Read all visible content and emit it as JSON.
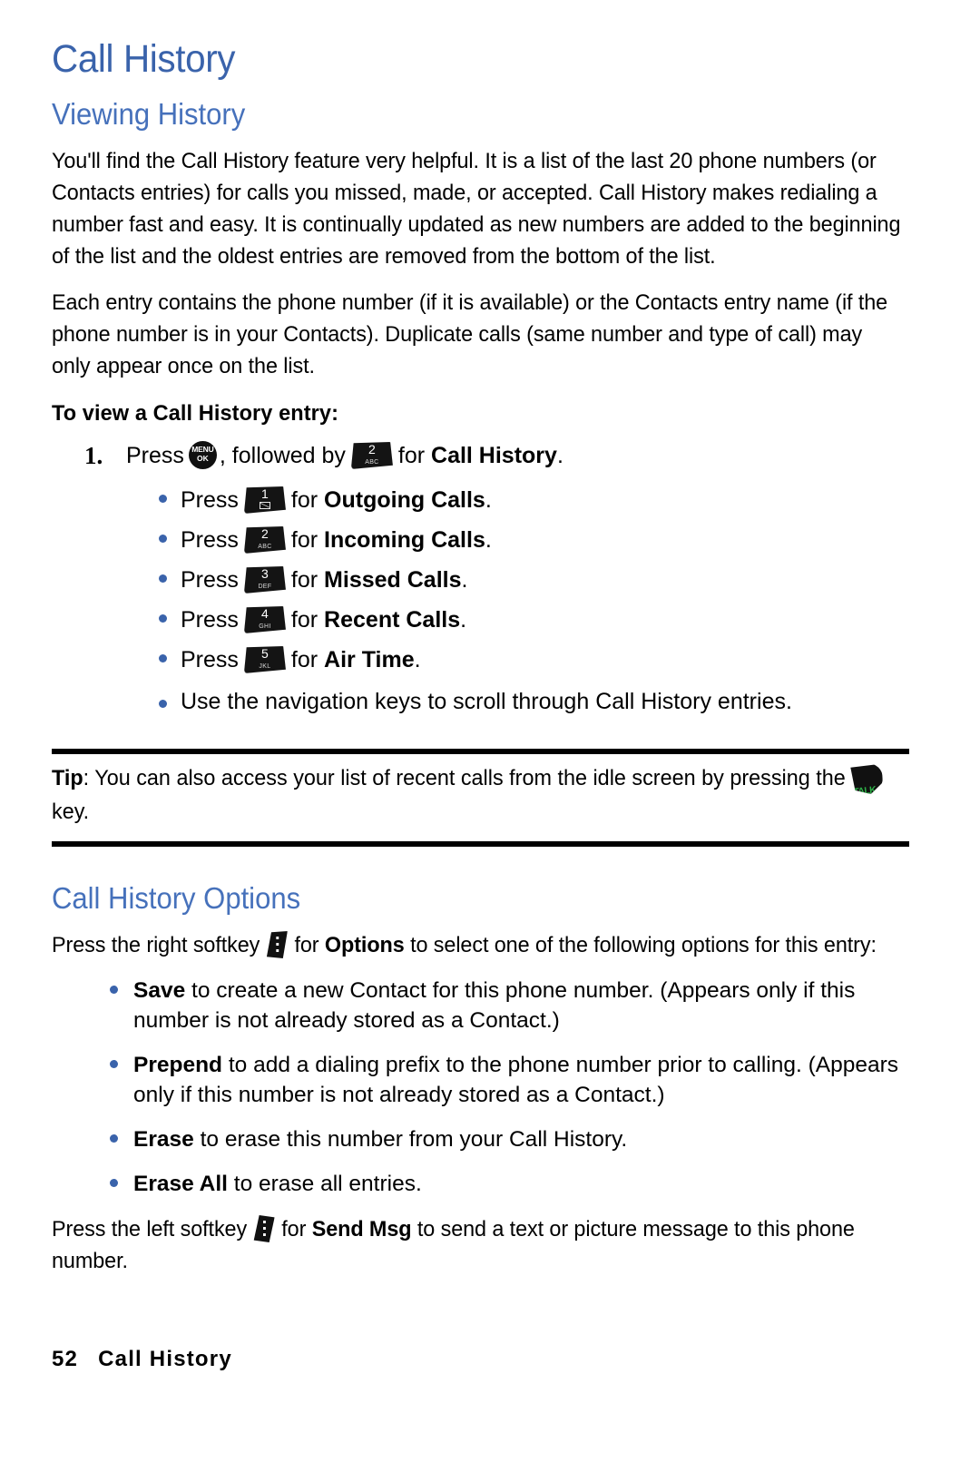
{
  "page": {
    "title": "Call History",
    "section_heading": "Viewing History",
    "paragraphs": [
      "You'll find the Call History feature very helpful. It is a list of the last 20 phone numbers (or Contacts entries) for calls you missed, made, or accepted. Call History makes redialing a number fast and easy. It is continually updated as new numbers are added to the beginning of the list and the oldest entries are removed from the bottom of the list.",
      "Each entry contains the phone number (if it is available) or the Contacts entry name (if the phone number is in your Contacts). Duplicate calls (same number and type of call) may only appear once on the list."
    ],
    "subhead": "To view a Call History entry:"
  },
  "step": {
    "number": "1.",
    "press_label": "Press",
    "comma_followed_by": ", followed by",
    "for_label": "for",
    "target": "Call History",
    "period": "."
  },
  "keys": {
    "menu_ok": {
      "top": "MENU",
      "bottom": "OK",
      "name": "menu-ok-key"
    },
    "k1": {
      "num": "1",
      "sub": "",
      "glyph": "envelope"
    },
    "k2": {
      "num": "2",
      "sub": "ABC"
    },
    "k3": {
      "num": "3",
      "sub": "DEF"
    },
    "k4": {
      "num": "4",
      "sub": "GHI"
    },
    "k5": {
      "num": "5",
      "sub": "JKL"
    },
    "talk": {
      "label": "TALK",
      "color": "#2eb148"
    }
  },
  "key_items": [
    {
      "press": "Press",
      "for": "for",
      "target": "Outgoing Calls",
      "key": "k1"
    },
    {
      "press": "Press",
      "for": "for",
      "target": "Incoming Calls",
      "key": "k2"
    },
    {
      "press": "Press",
      "for": "for",
      "target": "Missed Calls",
      "key": "k3"
    },
    {
      "press": "Press",
      "for": "for",
      "target": "Recent Calls",
      "key": "k4"
    },
    {
      "press": "Press",
      "for": "for",
      "target": "Air Time",
      "key": "k5"
    }
  ],
  "nav_item": "Use the navigation keys to scroll through Call History entries.",
  "tip": {
    "label": "Tip",
    "colon_text": ": You can also access your list of recent calls from the idle screen by pressing the",
    "tail": "key."
  },
  "options": {
    "heading": "Call History Options",
    "intro_pre": "Press the right softkey",
    "intro_mid": "for",
    "intro_bold": "Options",
    "intro_post": "to select one of the following options for this entry:",
    "items": [
      {
        "term": "Save",
        "text": "to create a new Contact for this phone number. (Appears only if this number is not already stored as a Contact.)"
      },
      {
        "term": "Prepend",
        "text": "to add a dialing prefix to the phone number prior to calling. (Appears only if this number is not already stored as a Contact.)"
      },
      {
        "term": "Erase",
        "text": "to erase this number from your Call History."
      },
      {
        "term": "Erase All",
        "text": "to erase all entries."
      }
    ],
    "outro_pre": "Press the left softkey",
    "outro_mid": "for",
    "outro_bold": "Send Msg",
    "outro_post": "to send a text or picture message to this phone number."
  },
  "footer": {
    "page_number": "52",
    "chapter": "Call History"
  },
  "colors": {
    "h1": "#3a63ab",
    "h2": "#4671bb",
    "bullet": "#3a63ab",
    "talk_green": "#2eb148",
    "rule": "#000000"
  }
}
